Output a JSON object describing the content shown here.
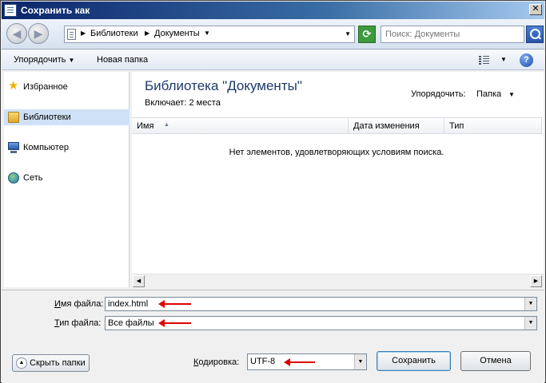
{
  "window": {
    "title": "Сохранить как",
    "close_glyph": "✕"
  },
  "addressbar": {
    "breadcrumb": [
      "Библиотеки",
      "Документы"
    ],
    "search_placeholder": "Поиск: Документы"
  },
  "toolbar": {
    "organize": "Упорядочить",
    "new_folder": "Новая папка",
    "help_glyph": "?"
  },
  "navpane": {
    "items": [
      {
        "label": "Избранное",
        "icon": "star-icon"
      },
      {
        "label": "Библиотеки",
        "icon": "library-icon",
        "selected": true
      },
      {
        "label": "Компьютер",
        "icon": "computer-icon"
      },
      {
        "label": "Сеть",
        "icon": "network-icon"
      }
    ]
  },
  "content": {
    "title": "Библиотека \"Документы\"",
    "includes": "Включает:  2 места",
    "arrange_label": "Упорядочить:",
    "arrange_value": "Папка",
    "columns": [
      "Имя",
      "Дата изменения",
      "Тип"
    ],
    "empty_message": "Нет элементов, удовлетворяющих условиям поиска."
  },
  "form": {
    "filename_label_u": "И",
    "filename_label_rest": "мя файла:",
    "filename_value": "index.html",
    "filetype_label_u": "Т",
    "filetype_label_rest": "ип файла:",
    "filetype_value": "Все файлы",
    "encoding_label_u": "К",
    "encoding_label_rest": "одировка:",
    "encoding_value": "UTF-8"
  },
  "buttons": {
    "hide_folders": "Скрыть папки",
    "save": "Сохранить",
    "cancel": "Отмена"
  },
  "colors": {
    "annotation_arrow": "#e00000",
    "selection": "#cfe1f6",
    "title_text": "#1e3a6a"
  }
}
